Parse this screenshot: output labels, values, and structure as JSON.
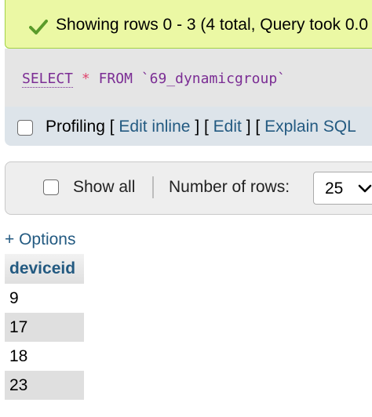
{
  "success_banner": {
    "icon": "check-icon",
    "message": "Showing rows 0 - 3 (4 total, Query took 0.0",
    "color": "#ebf8a4"
  },
  "sql_query": {
    "select": "SELECT",
    "star": "*",
    "from": "FROM",
    "table": "`69_dynamicgroup`"
  },
  "profiling_bar": {
    "profiling_label": "Profiling",
    "links": [
      "Edit inline",
      "Edit",
      "Explain SQL"
    ]
  },
  "navigation": {
    "show_all_label": "Show all",
    "number_of_rows_label": "Number of rows:",
    "rows_select_value": "25"
  },
  "options_link": "+ Options",
  "results_table": {
    "column": "deviceid",
    "rows": [
      "9",
      "17",
      "18",
      "23"
    ]
  },
  "colors": {
    "link": "#235a81",
    "keyword": "#7b2d94",
    "banner_border": "#a2d246"
  }
}
